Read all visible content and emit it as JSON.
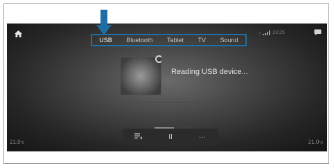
{
  "tabs": [
    {
      "label": "USB",
      "active": true
    },
    {
      "label": "Bluetooth",
      "active": false
    },
    {
      "label": "Tablet",
      "active": false
    },
    {
      "label": "TV",
      "active": false
    },
    {
      "label": "Sound",
      "active": false
    }
  ],
  "status": {
    "time": "23:25",
    "signal": "ᵢₗ"
  },
  "message": "Reading USB device...",
  "temperature": {
    "left": {
      "value": "21.0",
      "unit": "°C"
    },
    "right": {
      "value": "21.0",
      "unit": "°C"
    }
  },
  "progress": 0.5,
  "icons": {
    "home": "home-icon",
    "message": "message-icon",
    "arrow": "down-arrow-icon",
    "playlist": "playlist-icon",
    "pause": "pause-icon",
    "more": "more-icon"
  },
  "colors": {
    "highlight_border": "#1f6fa4",
    "arrow": "#1f6fa4",
    "screen_dark": "#141414"
  },
  "controls": {
    "pause_glyph": "II",
    "more_glyph": "···"
  }
}
